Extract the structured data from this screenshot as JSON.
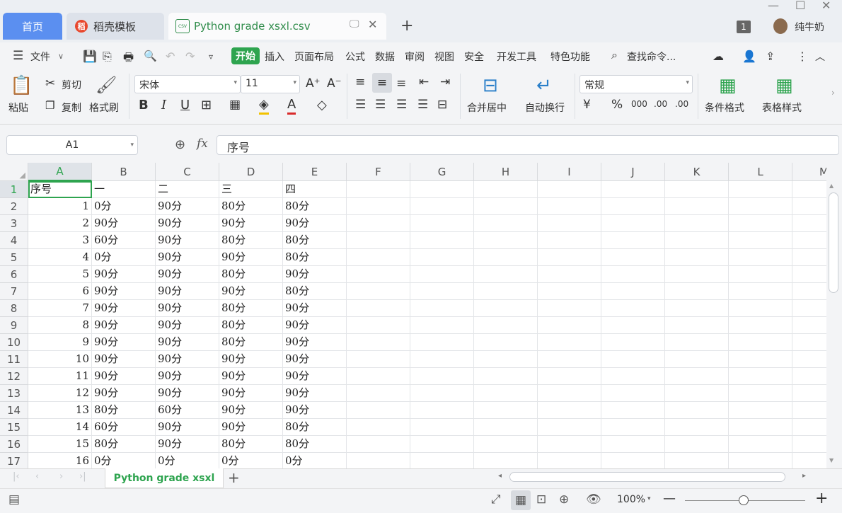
{
  "window": {
    "minimize": "—",
    "maximize": "☐",
    "close": "✕"
  },
  "tabs": {
    "home": "首页",
    "template": "稻壳模板",
    "file": "Python grade xsxl.csv",
    "add": "+"
  },
  "user": {
    "badge": "1",
    "name": "纯牛奶"
  },
  "menu": {
    "file": "文件",
    "items": [
      "开始",
      "插入",
      "页面布局",
      "公式",
      "数据",
      "审阅",
      "视图",
      "安全",
      "开发工具",
      "特色功能"
    ],
    "search": "查找命令..."
  },
  "toolbar": {
    "paste": "粘贴",
    "cut": "剪切",
    "copy": "复制",
    "format_painter": "格式刷",
    "font": "宋体",
    "size": "11",
    "bold": "B",
    "italic": "I",
    "underline": "U",
    "merge": "合并居中",
    "wrap": "自动换行",
    "number_format": "常规",
    "cond_format": "条件格式",
    "table_style": "表格样式"
  },
  "formula": {
    "cell_ref": "A1",
    "fx": "fx",
    "value": "序号"
  },
  "columns": [
    "A",
    "B",
    "C",
    "D",
    "E",
    "F",
    "G",
    "H",
    "I",
    "J",
    "K",
    "L",
    "M"
  ],
  "rows": [
    [
      "序号",
      "一",
      "二",
      "三",
      "四"
    ],
    [
      "1",
      "0分",
      "90分",
      "80分",
      "80分"
    ],
    [
      "2",
      "90分",
      "90分",
      "90分",
      "90分"
    ],
    [
      "3",
      "60分",
      "90分",
      "80分",
      "80分"
    ],
    [
      "4",
      "0分",
      "90分",
      "90分",
      "80分"
    ],
    [
      "5",
      "90分",
      "90分",
      "80分",
      "90分"
    ],
    [
      "6",
      "90分",
      "90分",
      "90分",
      "80分"
    ],
    [
      "7",
      "90分",
      "90分",
      "80分",
      "90分"
    ],
    [
      "8",
      "90分",
      "90分",
      "80分",
      "90分"
    ],
    [
      "9",
      "90分",
      "90分",
      "80分",
      "90分"
    ],
    [
      "10",
      "90分",
      "90分",
      "90分",
      "90分"
    ],
    [
      "11",
      "90分",
      "90分",
      "90分",
      "90分"
    ],
    [
      "12",
      "90分",
      "90分",
      "90分",
      "90分"
    ],
    [
      "13",
      "80分",
      "60分",
      "90分",
      "90分"
    ],
    [
      "14",
      "60分",
      "90分",
      "90分",
      "80分"
    ],
    [
      "15",
      "80分",
      "90分",
      "80分",
      "80分"
    ],
    [
      "16",
      "0分",
      "0分",
      "0分",
      "0分"
    ]
  ],
  "sheet": {
    "name": "Python grade xsxl",
    "add": "+"
  },
  "status": {
    "zoom": "100%",
    "zoom_out": "—",
    "zoom_in": "+"
  },
  "colors": {
    "accent": "#2ea44f",
    "home_tab": "#5b8ff0",
    "selected_cell": "#2ea44f"
  }
}
